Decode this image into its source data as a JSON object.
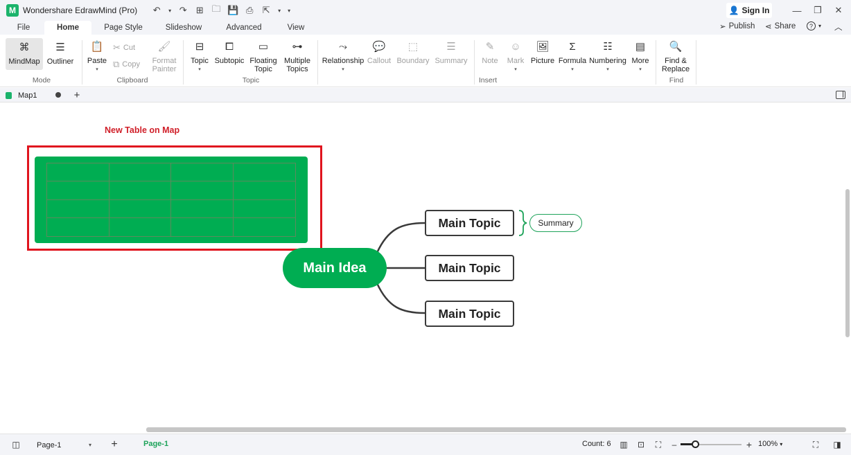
{
  "app": {
    "title": "Wondershare EdrawMind (Pro)",
    "logo_glyph": "M",
    "sign_in": "Sign In",
    "accent_color": "#00ad52"
  },
  "quick_access": {
    "undo": "↶",
    "undo_caret": "▾",
    "redo": "↷",
    "new": "⊞",
    "open": "🗀",
    "save": "💾",
    "print": "⎙",
    "export": "⇱",
    "export_caret": "▾",
    "customize": "▾"
  },
  "window_controls": {
    "minimize": "—",
    "restore": "❐",
    "close": "✕"
  },
  "menu": {
    "tabs": [
      "File",
      "Home",
      "Page Style",
      "Slideshow",
      "Advanced",
      "View"
    ],
    "active": "Home",
    "publish": "Publish",
    "share": "Share",
    "help": "?",
    "help_caret": "▾",
    "collapse": "︿"
  },
  "ribbon": {
    "mode": {
      "label": "Mode",
      "mindmap": "MindMap",
      "outliner": "Outliner"
    },
    "clipboard": {
      "label": "Clipboard",
      "paste": "Paste",
      "cut": "Cut",
      "copy": "Copy",
      "format_painter": [
        "Format",
        "Painter"
      ]
    },
    "topic": {
      "label": "Topic",
      "topic": "Topic",
      "subtopic": "Subtopic",
      "floating": [
        "Floating",
        "Topic"
      ],
      "multiple": [
        "Multiple",
        "Topics"
      ]
    },
    "insert": {
      "label": "Insert",
      "relationship": "Relationship",
      "callout": "Callout",
      "boundary": "Boundary",
      "summary": "Summary",
      "note": "Note",
      "mark": "Mark",
      "picture": "Picture",
      "formula": "Formula",
      "numbering": "Numbering",
      "more": "More"
    },
    "find": {
      "label": "Find",
      "find_replace": [
        "Find &",
        "Replace"
      ]
    },
    "caret": "▾"
  },
  "doc_tabs": {
    "current": "Map1",
    "add": "+"
  },
  "canvas": {
    "annotation": "New Table on Map",
    "table": {
      "rows": 4,
      "cols": 4
    },
    "main_idea": "Main Idea",
    "topics": [
      "Main Topic",
      "Main Topic",
      "Main Topic"
    ],
    "summary": "Summary"
  },
  "status": {
    "page_select": "Page-1",
    "page_tab": "Page-1",
    "add_page": "+",
    "count": "Count: 6",
    "zoom_minus": "–",
    "zoom_plus": "+",
    "zoom": "100%",
    "zoom_level_percent": 100
  }
}
